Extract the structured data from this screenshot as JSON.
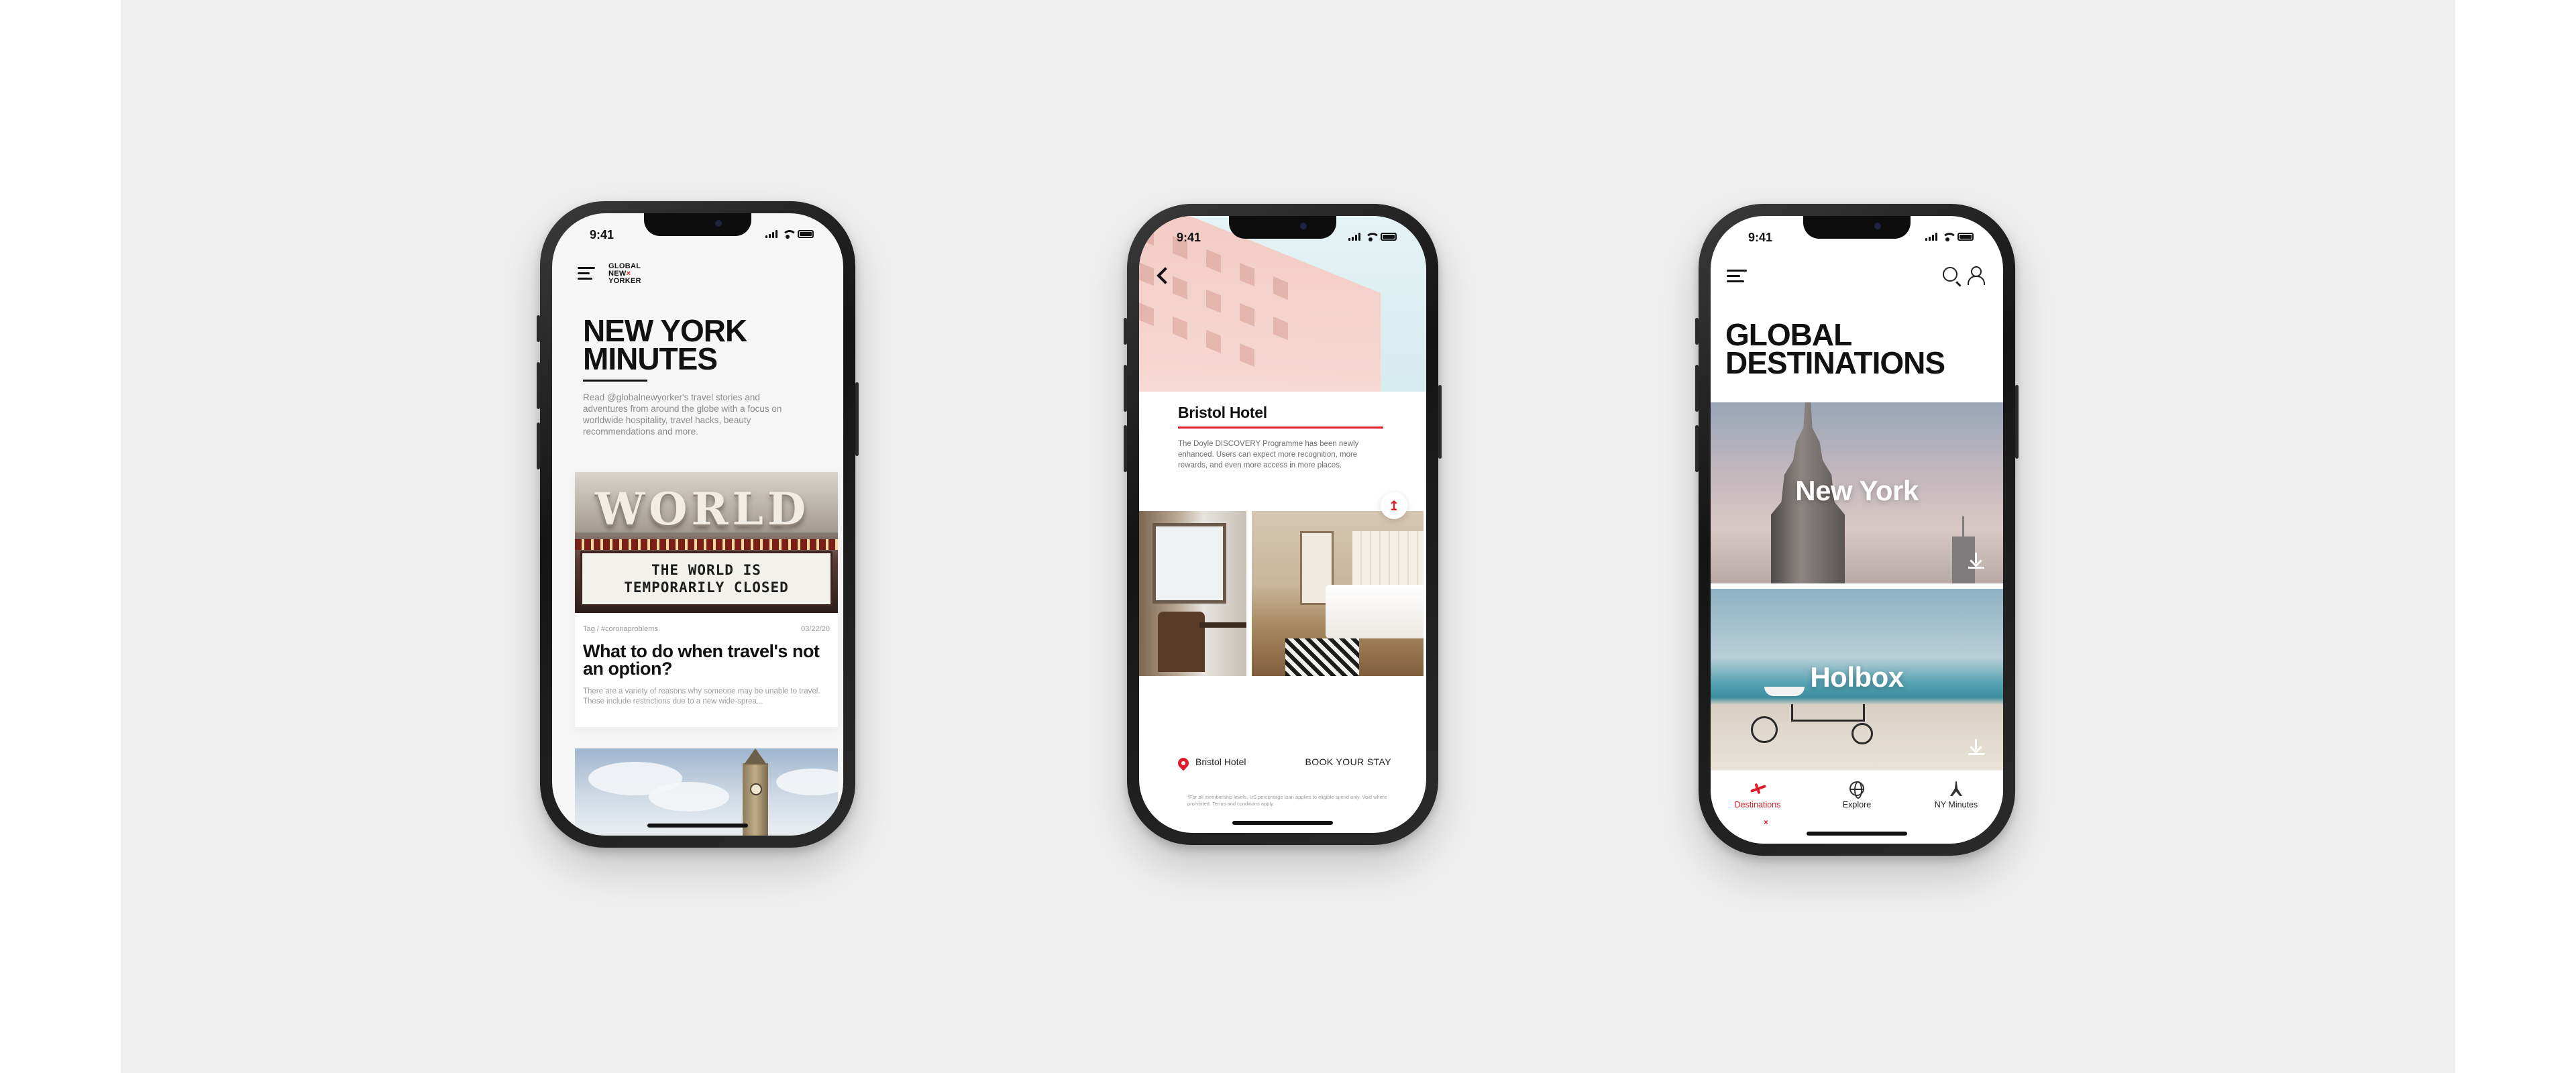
{
  "status": {
    "time": "9:41"
  },
  "phone1": {
    "logo": [
      "GLOBAL",
      "NEW",
      "YORKER"
    ],
    "logo_mark": "×",
    "title": "NEW YORK MINUTES",
    "description": "Read @globalnewyorker's travel stories and adventures from around the globe with a focus on worldwide hospitality, travel hacks, beauty recommendations and more.",
    "article": {
      "image_word": "WORLD",
      "marquee_line1": "THE WORLD IS",
      "marquee_line2": "TEMPORARILY CLOSED",
      "tag": "Tag / #coronaproblems",
      "date": "03/22/20",
      "headline": "What to do when travel's not an option?",
      "excerpt": "There are a variety of reasons why someone may be unable to travel. These include restrictions due to a new wide-sprea..."
    }
  },
  "phone2": {
    "hotel_name": "Bristol Hotel",
    "description": "The Doyle DISCOVERY Programme has been newly enhanced. Users can expect more recognition, more rewards, and even more access in more places.",
    "share_symbol": "↥",
    "location": "Bristol Hotel",
    "book_label": "BOOK YOUR STAY",
    "fine_print": "*For all membership levels. US percentage loan applies to eligible spend only. Void where prohibited. Terms and conditions apply."
  },
  "phone3": {
    "title": "GLOBAL DESTINATIONS",
    "destinations": [
      {
        "name": "New York"
      },
      {
        "name": "Holbox"
      }
    ],
    "tabs": [
      {
        "label": "Destinations",
        "icon": "plane-icon",
        "active": true
      },
      {
        "label": "Explore",
        "icon": "globe-icon",
        "active": false
      },
      {
        "label": "NY Minutes",
        "icon": "eiffel-tower-icon",
        "active": false
      }
    ],
    "tab_indicator": "×"
  },
  "colors": {
    "accent": "#e21d2b",
    "background": "#efefef",
    "text": "#111111"
  },
  "icons": [
    "menu-icon",
    "search-icon",
    "user-icon",
    "back-chevron-icon",
    "share-icon",
    "location-pin-icon",
    "download-icon",
    "plane-icon",
    "globe-icon",
    "eiffel-tower-icon"
  ]
}
